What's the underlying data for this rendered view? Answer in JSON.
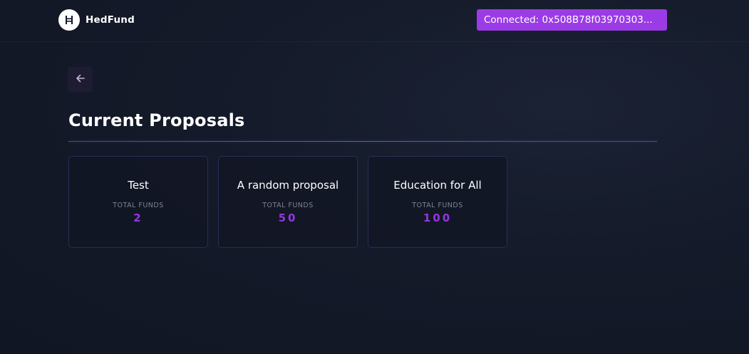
{
  "header": {
    "brand": "HedFund",
    "wallet_status": "Connected: 0x508B78f03970303..."
  },
  "page": {
    "title": "Current Proposals",
    "back_icon": "arrow-left-icon"
  },
  "proposals": [
    {
      "title": "Test",
      "funds_label": "TOTAL FUNDS",
      "funds": "2"
    },
    {
      "title": "A random proposal",
      "funds_label": "TOTAL FUNDS",
      "funds": "50"
    },
    {
      "title": "Education for All",
      "funds_label": "TOTAL FUNDS",
      "funds": "100"
    }
  ],
  "colors": {
    "accent": "#9b3be6",
    "funds_value": "#9436e0",
    "background": "#141a29",
    "card_border": "#2c2b57"
  }
}
